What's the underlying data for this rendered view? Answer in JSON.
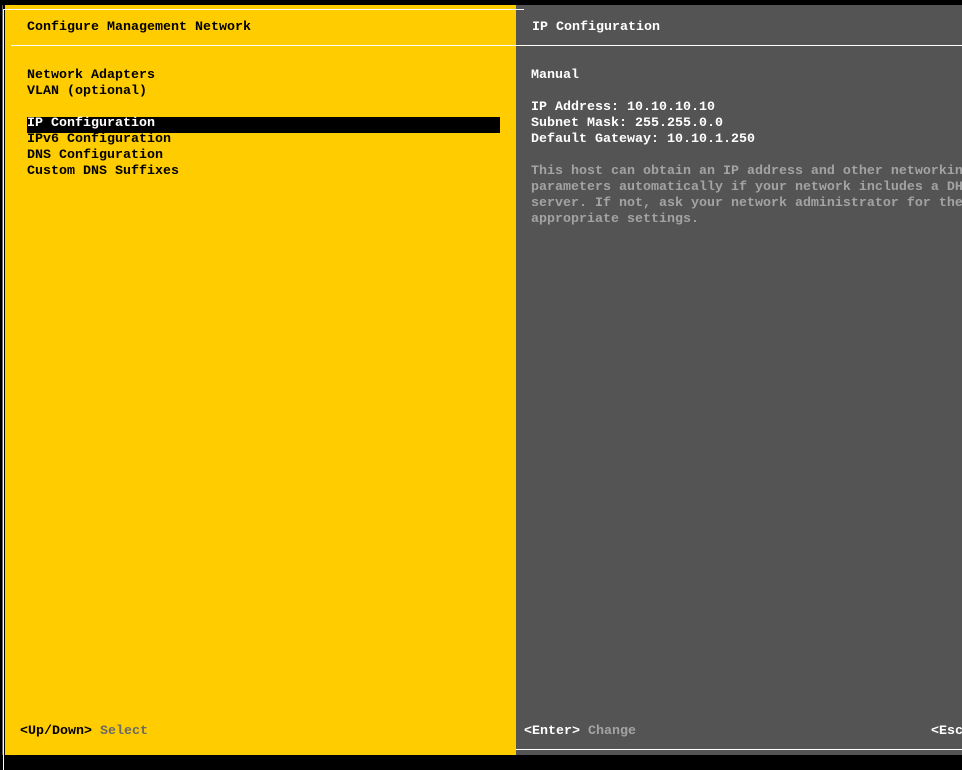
{
  "left_panel": {
    "title": "Configure Management Network",
    "menu_items": [
      {
        "label": "Network Adapters",
        "selected": false
      },
      {
        "label": "VLAN (optional)",
        "selected": false
      },
      {
        "label": "IP Configuration",
        "selected": true
      },
      {
        "label": "IPv6 Configuration",
        "selected": false
      },
      {
        "label": "DNS Configuration",
        "selected": false
      },
      {
        "label": "Custom DNS Suffixes",
        "selected": false
      }
    ],
    "footer_key": "<Up/Down>",
    "footer_action": "Select"
  },
  "right_panel": {
    "title": "IP Configuration",
    "mode": "Manual",
    "ip_address": "IP Address: 10.10.10.10",
    "subnet_mask": "Subnet Mask: 255.255.0.0",
    "default_gateway": "Default Gateway: 10.10.1.250",
    "description": [
      "This host can obtain an IP address and other networkin",
      "parameters automatically if your network includes a DH",
      "server. If not, ask your network administrator for the",
      "appropriate settings."
    ],
    "footer_key": "<Enter>",
    "footer_action": "Change",
    "footer_key2": "<Esc"
  },
  "colors": {
    "panel_yellow": "#ffcc00",
    "panel_gray": "#545454",
    "muted_text": "#a3a3a3"
  }
}
